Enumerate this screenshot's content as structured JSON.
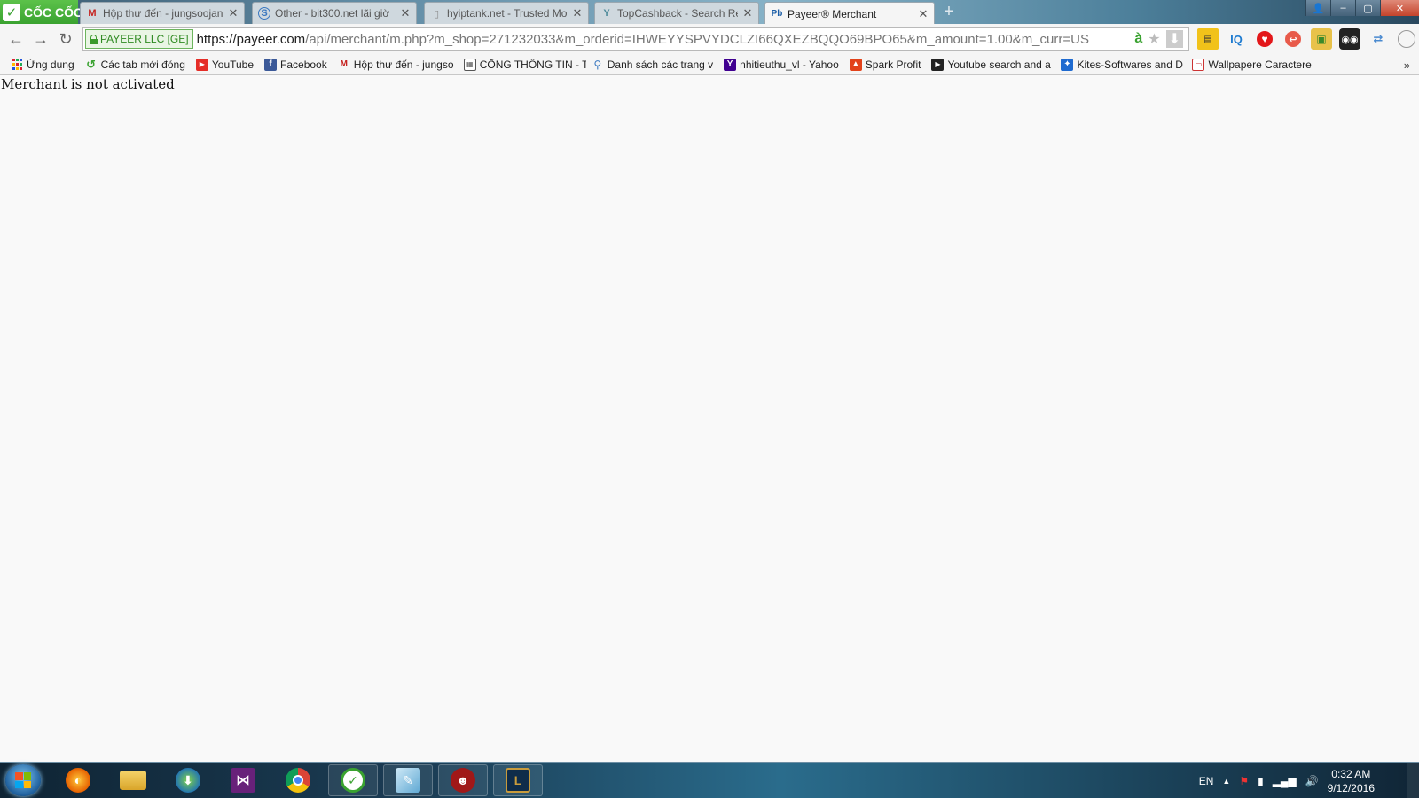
{
  "browser": {
    "brand": "CỐC CỐC",
    "tabs": [
      {
        "title": "Hộp thư đến - jungsoojan",
        "icon": "gmail-icon"
      },
      {
        "title": "Other - bit300.net lãi giờ",
        "icon": "bit300-icon"
      },
      {
        "title": "hyiptank.net - Trusted Mo",
        "icon": "page-icon"
      },
      {
        "title": "TopCashback - Search Res",
        "icon": "topcashback-icon"
      },
      {
        "title": "Payeer® Merchant",
        "icon": "payeer-icon",
        "active": true
      }
    ],
    "new_tab": "+",
    "window_buttons": {
      "minimize": "–",
      "maximize": "▢",
      "close": "✕"
    }
  },
  "toolbar": {
    "back": "←",
    "forward": "→",
    "reload": "↻",
    "ev_label": "PAYEER LLC [GE]",
    "url_host": "https://payeer.com",
    "url_rest": "/api/merchant/m.php?m_shop=271232033&m_orderid=IHWEYYSPVYDCLZI66QXEZBQQO69BPO65&m_amount=1.00&m_curr=US",
    "omni_a": "à",
    "extensions": [
      "IQ"
    ]
  },
  "bookmarks": [
    {
      "label": "Ứng dụng",
      "icon": "apps-icon"
    },
    {
      "label": "Các tab mới đóng",
      "icon": "history-icon"
    },
    {
      "label": "YouTube",
      "icon": "youtube-icon"
    },
    {
      "label": "Facebook",
      "icon": "facebook-icon"
    },
    {
      "label": "Hộp thư đến - jungso",
      "icon": "gmail-icon"
    },
    {
      "label": "CỔNG THÔNG TIN - T",
      "icon": "portal-icon"
    },
    {
      "label": "Danh sách các trang v",
      "icon": "list-icon"
    },
    {
      "label": "nhitieuthu_vl - Yahoo",
      "icon": "yahoo-icon"
    },
    {
      "label": "Spark Profit",
      "icon": "spark-icon"
    },
    {
      "label": "Youtube search and a",
      "icon": "video-icon"
    },
    {
      "label": "Kites-Softwares and D",
      "icon": "kites-icon"
    },
    {
      "label": "Wallpapere Caractere",
      "icon": "wallpaper-icon"
    }
  ],
  "bookmarks_more": "»",
  "page": {
    "message": "Merchant is not activated"
  },
  "taskbar": {
    "apps": [
      "firefox",
      "explorer",
      "idm",
      "visual-studio",
      "chrome",
      "coccoc",
      "notepad",
      "game",
      "league"
    ],
    "language": "EN",
    "tray_arrow": "▲",
    "time": "0:32 AM",
    "date": "9/12/2016"
  }
}
